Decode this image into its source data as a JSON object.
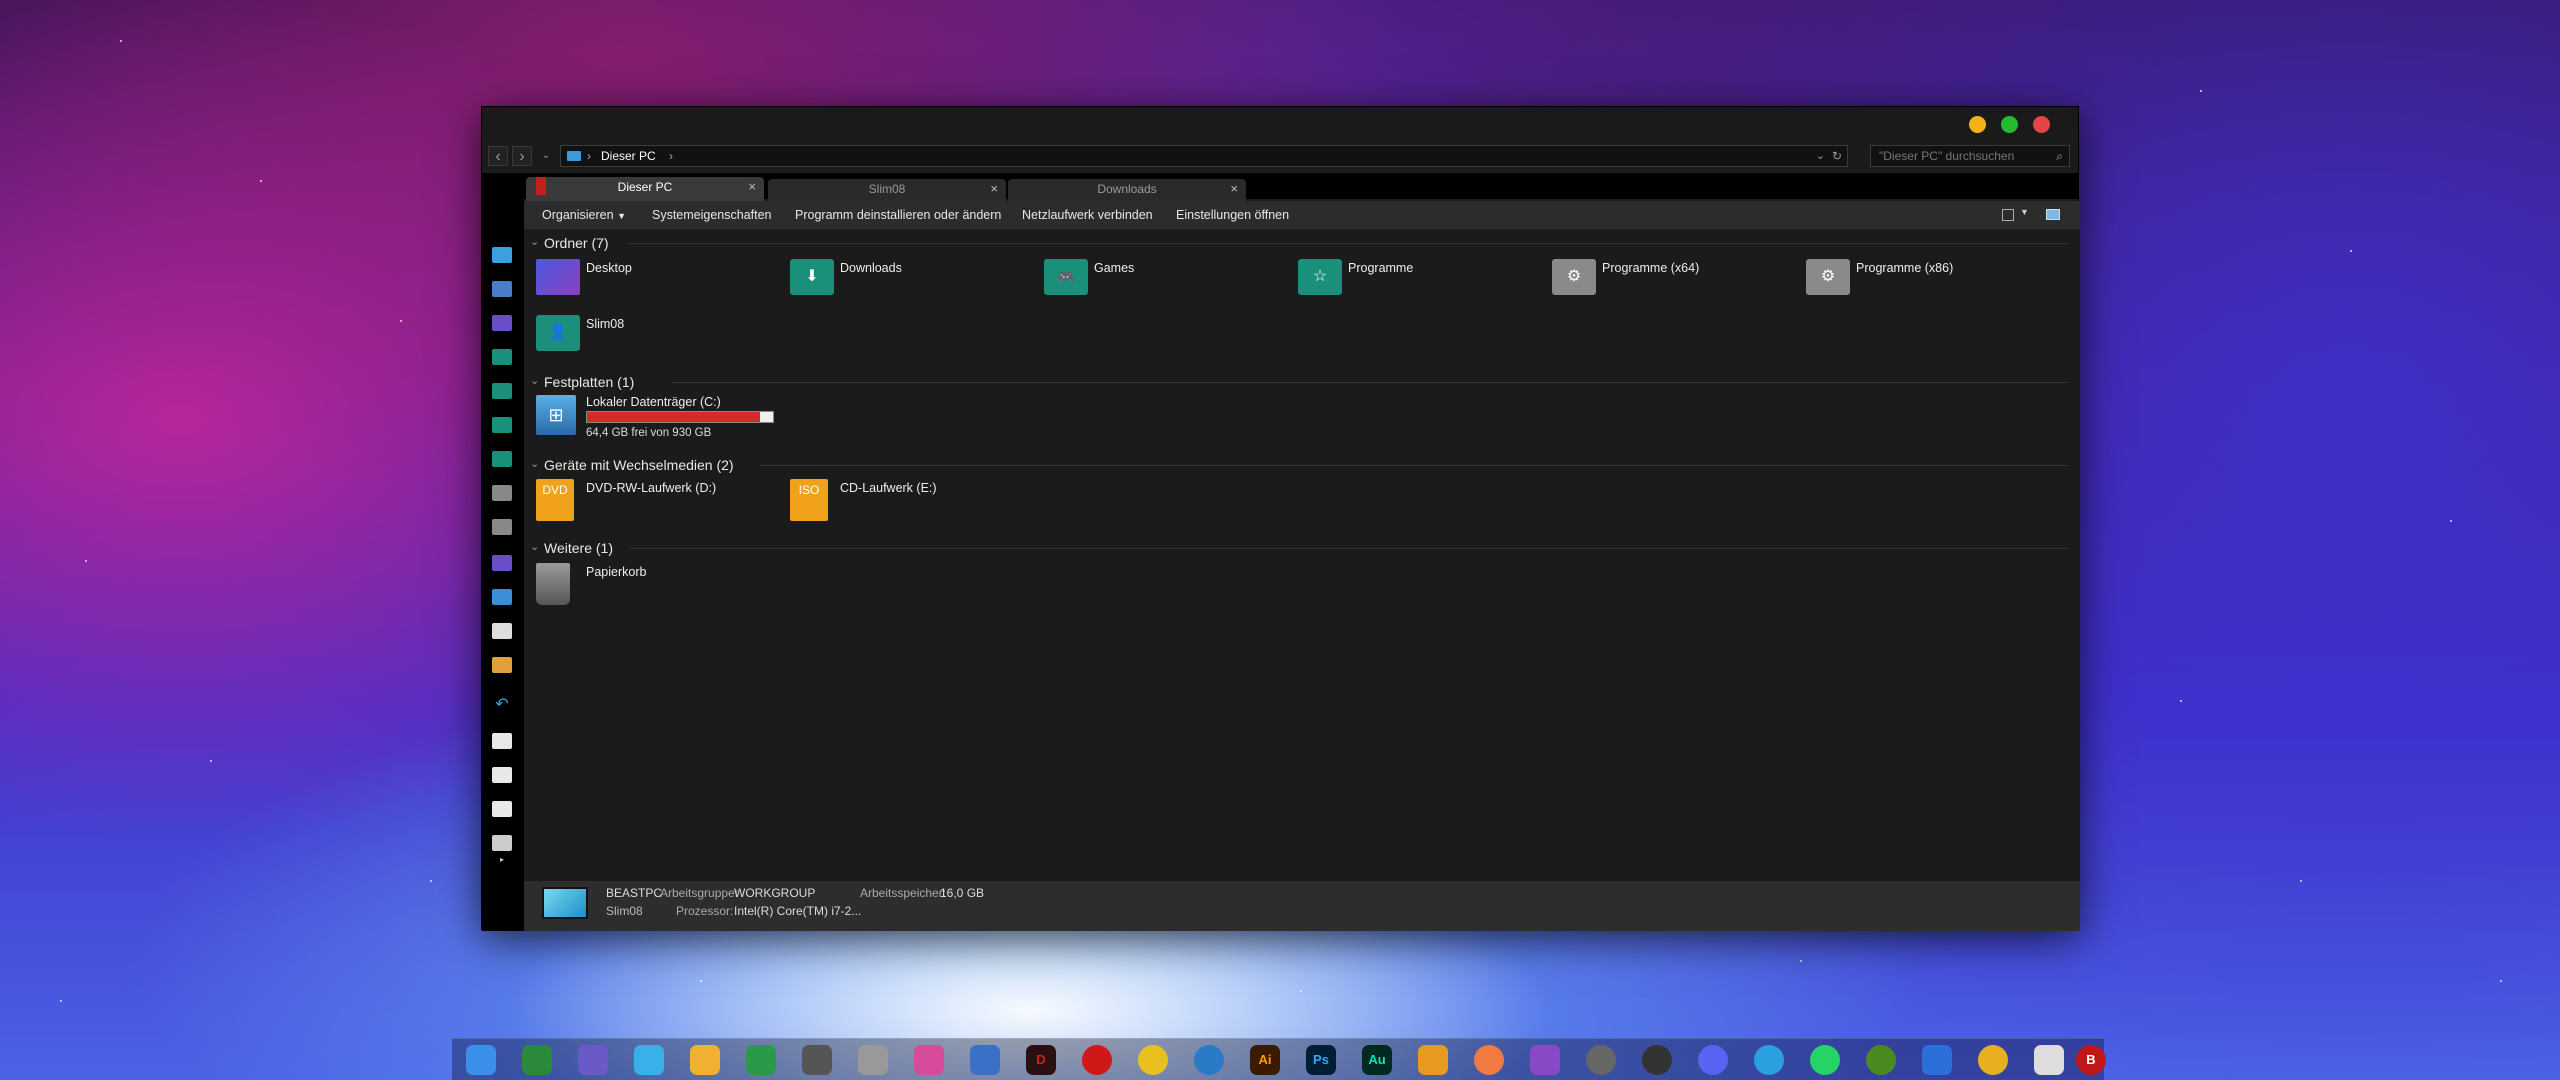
{
  "window": {
    "title_buttons": [
      "minimize",
      "maximize",
      "close"
    ]
  },
  "address": {
    "location": "Dieser PC",
    "separator": "›",
    "search_placeholder": "\"Dieser PC\" durchsuchen"
  },
  "tabs": [
    {
      "label": "Dieser PC"
    },
    {
      "label": "Slim08"
    },
    {
      "label": "Downloads"
    }
  ],
  "toolbar": {
    "organize": "Organisieren",
    "system_props": "Systemeigenschaften",
    "uninstall": "Programm deinstallieren oder ändern",
    "network_drive": "Netzlaufwerk verbinden",
    "settings": "Einstellungen öffnen"
  },
  "groups": {
    "folders": {
      "title": "Ordner (7)",
      "items": [
        "Desktop",
        "Downloads",
        "Games",
        "Programme",
        "Programme (x64)",
        "Programme (x86)",
        "Slim08"
      ]
    },
    "drives": {
      "title": "Festplatten (1)",
      "items": [
        {
          "label": "Lokaler Datenträger (C:)",
          "free": "64,4 GB frei von 930 GB",
          "used_fraction": 0.93
        }
      ]
    },
    "removable": {
      "title": "Geräte mit Wechselmedien (2)",
      "items": [
        {
          "label": "DVD-RW-Laufwerk (D:)",
          "badge": "DVD"
        },
        {
          "label": "CD-Laufwerk (E:)",
          "badge": "ISO"
        }
      ]
    },
    "other": {
      "title": "Weitere (1)",
      "items": [
        "Papierkorb"
      ]
    }
  },
  "status": {
    "pc_name": "BEASTPC",
    "user": "Slim08",
    "workgroup_label": "Arbeitsgruppe:",
    "workgroup": "WORKGROUP",
    "cpu_label": "Prozessor:",
    "cpu": "Intel(R) Core(TM) i7-2...",
    "ram_label": "Arbeitsspeicher:",
    "ram": "16,0 GB"
  },
  "colors": {
    "folder": "#1a8f7a",
    "drive_bar": "#d42a2a",
    "dvd": "#f0a21a",
    "traffic_yellow": "#f3b218",
    "traffic_green": "#28b932",
    "traffic_red": "#e64545"
  },
  "dock": {
    "labels": [
      "Ai",
      "Ps",
      "Au",
      "B"
    ]
  }
}
